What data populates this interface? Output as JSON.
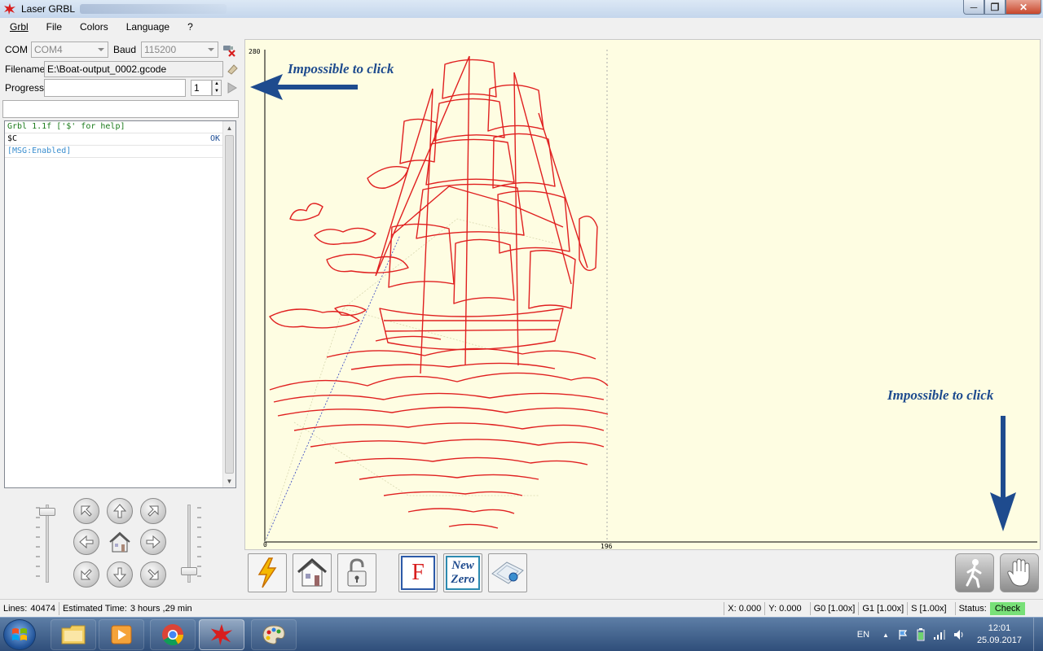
{
  "window": {
    "title": "Laser GRBL",
    "minimize": "─",
    "maximize": "❐",
    "close": "✕"
  },
  "menu": [
    "Grbl",
    "File",
    "Colors",
    "Language",
    "?"
  ],
  "connection": {
    "com_label": "COM",
    "com_value": "COM4",
    "baud_label": "Baud",
    "baud_value": "115200"
  },
  "file": {
    "filename_label": "Filename",
    "filename_value": "E:\\Boat-output_0002.gcode",
    "progress_label": "Progress",
    "progress_value": "",
    "copies_value": "1"
  },
  "command_input": {
    "value": ""
  },
  "console": {
    "lines": [
      {
        "text": "Grbl 1.1f ['$' for help]",
        "result": "",
        "style": "green"
      },
      {
        "text": "$C",
        "result": "OK",
        "style": "plain"
      },
      {
        "text": "[MSG:Enabled]",
        "result": "",
        "style": "blue"
      }
    ]
  },
  "jog": {
    "speed_level": 0.95,
    "step_level": 0.1
  },
  "canvas": {
    "y_max_label": "280",
    "x_max_label": "196",
    "origin_label": "0",
    "background": "#fefde2",
    "drawing_color": "#e02020"
  },
  "annotations": {
    "top_left": "Impossible to click",
    "bottom_right": "Impossible to click",
    "color": "#1e4b8e"
  },
  "toolbar": {
    "override_f_label": "F",
    "new_zero_label_1": "New",
    "new_zero_label_2": "Zero"
  },
  "status": {
    "lines_label": "Lines:",
    "lines_value": "40474",
    "time_label": "Estimated Time:",
    "time_value": "3 hours ,29 min",
    "x": "X: 0.000",
    "y": "Y: 0.000",
    "g0": "G0 [1.00x]",
    "g1": "G1 [1.00x]",
    "s": "S [1.00x]",
    "status_label": "Status:",
    "status_value": "Check",
    "status_color": "#78e078"
  },
  "taskbar": {
    "language": "EN",
    "time": "12:01",
    "date": "25.09.2017"
  }
}
